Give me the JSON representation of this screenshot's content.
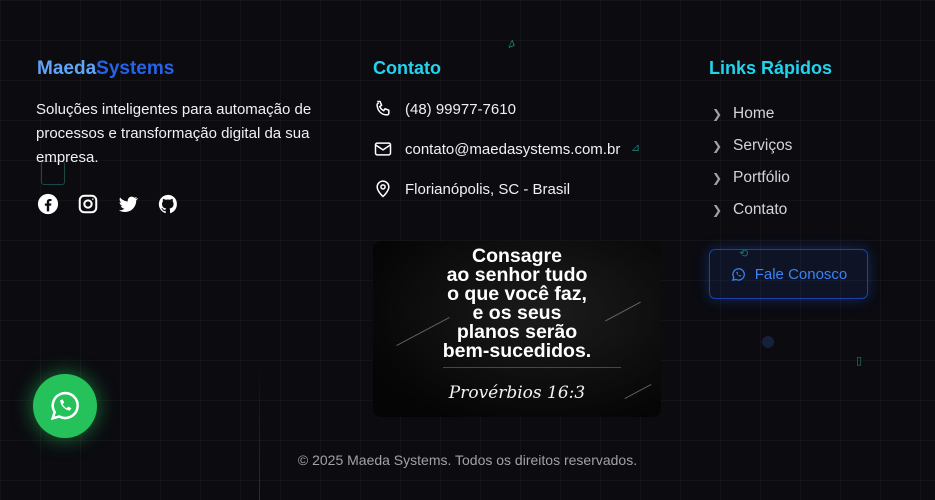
{
  "brand": {
    "part1": "Maeda",
    "part2": "Systems"
  },
  "about": {
    "description": "Soluções inteligentes para automação de processos e transformação digital da sua empresa."
  },
  "socials": [
    {
      "name": "facebook-icon"
    },
    {
      "name": "instagram-icon"
    },
    {
      "name": "twitter-icon"
    },
    {
      "name": "github-icon"
    }
  ],
  "contact": {
    "heading": "Contato",
    "phone": "(48) 99977-7610",
    "email": "contato@maedasystems.com.br",
    "location": "Florianópolis, SC - Brasil"
  },
  "verse": {
    "lines": [
      "Consagre",
      "ao senhor tudo",
      "o que você faz,",
      "e os seus",
      "planos serão",
      "bem-sucedidos."
    ],
    "reference": "Provérbios 16:3"
  },
  "quick_links": {
    "heading": "Links Rápidos",
    "items": [
      "Home",
      "Serviços",
      "Portfólio",
      "Contato"
    ]
  },
  "cta": {
    "label": "Fale Conosco"
  },
  "footer": {
    "copyright": "© 2025 Maeda Systems. Todos os direitos reservados."
  },
  "colors": {
    "accent": "#22d3ee",
    "brand_light": "#60a5fa",
    "brand_dark": "#2563eb",
    "whatsapp": "#25c15a"
  }
}
